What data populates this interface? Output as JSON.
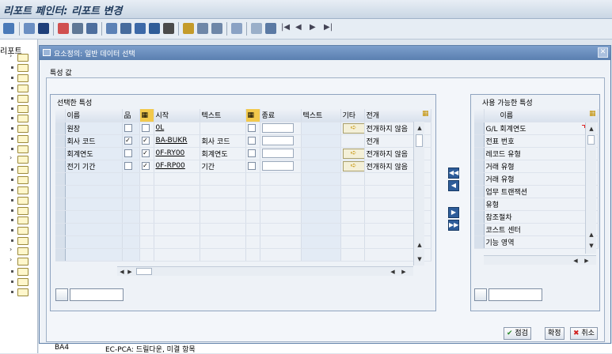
{
  "window": {
    "title": "리포트 페인터: 리포트 변경"
  },
  "tree": {
    "header": "리포트",
    "bottom_node": "BA4",
    "bottom_desc": "EC-PCA: 드릴다운, 미결 항목"
  },
  "dialog": {
    "title": "요소정의: 일반 데이터 선택",
    "close": "✕",
    "group_label": "특성 값",
    "selected_label": "선택한 특성",
    "available_label": "사용 가능한 특성",
    "columns": {
      "name": "이름",
      "start": "시작",
      "text": "텍스트",
      "end": "종료",
      "text2": "텍스트",
      "other": "기타",
      "expand": "전개"
    },
    "rows": [
      {
        "name": "원장",
        "c1": false,
        "c2": false,
        "start": "0L",
        "text": "",
        "end": "",
        "text2": "",
        "other": true,
        "expand": "전개하지 않음"
      },
      {
        "name": "회사 코드",
        "c1": true,
        "c2": true,
        "start": "BA-BUKR",
        "text": "회사 코드",
        "end": "",
        "text2": "",
        "other": false,
        "expand": "전개"
      },
      {
        "name": "회계연도",
        "c1": false,
        "c2": true,
        "start": "0F-RY00",
        "text": "회계연도",
        "end": "",
        "text2": "",
        "other": true,
        "expand": "전개하지 않음"
      },
      {
        "name": "전기 기간",
        "c1": false,
        "c2": true,
        "start": "0F-RP00",
        "text": "기간",
        "end": "",
        "text2": "",
        "other": true,
        "expand": "전개하지 않음"
      }
    ],
    "available": {
      "col": "이름",
      "items": [
        "G/L 회계연도",
        "전표 번호",
        "레코드 유형",
        "거래 유형",
        "거래 유형",
        "업무 트랜잭션",
        "유형",
        "참조절차",
        "코스트 센터",
        "기능 영역"
      ]
    },
    "buttons": {
      "check": "점검",
      "confirm": "확정",
      "cancel": "취소"
    }
  }
}
